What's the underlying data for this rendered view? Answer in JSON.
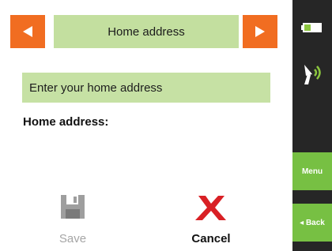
{
  "header": {
    "title": "Home address",
    "prev_icon": "arrow-left-icon",
    "next_icon": "arrow-right-icon"
  },
  "prompt": "Enter your home address",
  "field_label": "Home address:",
  "actions": {
    "save_label": "Save",
    "save_enabled": false,
    "cancel_label": "Cancel"
  },
  "sidebar": {
    "battery_icon": "battery-icon",
    "gps_icon": "gps-signal-icon",
    "menu_label": "Menu",
    "back_label": "◂ Back"
  },
  "colors": {
    "accent_orange": "#f16d21",
    "title_green": "#c3df9f",
    "button_green": "#77c043",
    "sidebar_dark": "#262626",
    "cancel_red": "#d92025"
  }
}
